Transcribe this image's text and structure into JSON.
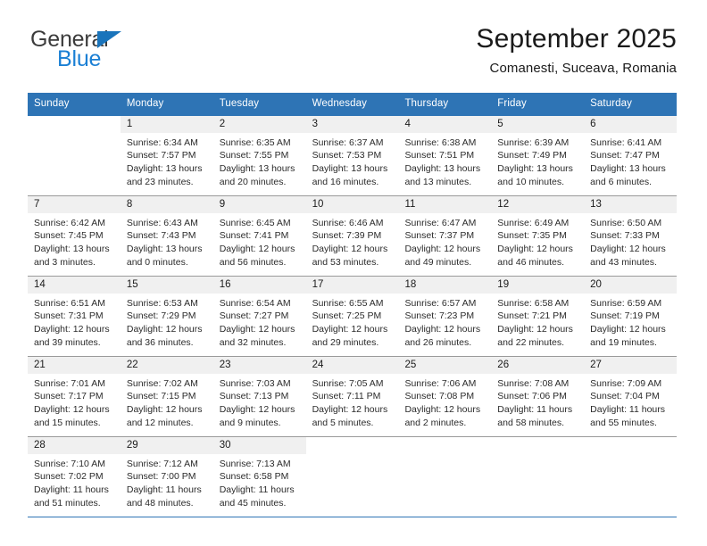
{
  "logo": {
    "word_one": "General",
    "word_two": "Blue",
    "triangle_icon": "triangle-icon",
    "brand_blue": "#1a7fd4",
    "brand_dark": "#3b3b3b"
  },
  "header": {
    "title": "September 2025",
    "subtitle": "Comanesti, Suceava, Romania"
  },
  "calendar": {
    "header_bg": "#2e74b5",
    "weekdays": [
      "Sunday",
      "Monday",
      "Tuesday",
      "Wednesday",
      "Thursday",
      "Friday",
      "Saturday"
    ],
    "weeks": [
      [
        {
          "day": "",
          "sunrise": "",
          "sunset": "",
          "daylight_line1": "",
          "daylight_line2": ""
        },
        {
          "day": "1",
          "sunrise": "Sunrise: 6:34 AM",
          "sunset": "Sunset: 7:57 PM",
          "daylight_line1": "Daylight: 13 hours",
          "daylight_line2": "and 23 minutes."
        },
        {
          "day": "2",
          "sunrise": "Sunrise: 6:35 AM",
          "sunset": "Sunset: 7:55 PM",
          "daylight_line1": "Daylight: 13 hours",
          "daylight_line2": "and 20 minutes."
        },
        {
          "day": "3",
          "sunrise": "Sunrise: 6:37 AM",
          "sunset": "Sunset: 7:53 PM",
          "daylight_line1": "Daylight: 13 hours",
          "daylight_line2": "and 16 minutes."
        },
        {
          "day": "4",
          "sunrise": "Sunrise: 6:38 AM",
          "sunset": "Sunset: 7:51 PM",
          "daylight_line1": "Daylight: 13 hours",
          "daylight_line2": "and 13 minutes."
        },
        {
          "day": "5",
          "sunrise": "Sunrise: 6:39 AM",
          "sunset": "Sunset: 7:49 PM",
          "daylight_line1": "Daylight: 13 hours",
          "daylight_line2": "and 10 minutes."
        },
        {
          "day": "6",
          "sunrise": "Sunrise: 6:41 AM",
          "sunset": "Sunset: 7:47 PM",
          "daylight_line1": "Daylight: 13 hours",
          "daylight_line2": "and 6 minutes."
        }
      ],
      [
        {
          "day": "7",
          "sunrise": "Sunrise: 6:42 AM",
          "sunset": "Sunset: 7:45 PM",
          "daylight_line1": "Daylight: 13 hours",
          "daylight_line2": "and 3 minutes."
        },
        {
          "day": "8",
          "sunrise": "Sunrise: 6:43 AM",
          "sunset": "Sunset: 7:43 PM",
          "daylight_line1": "Daylight: 13 hours",
          "daylight_line2": "and 0 minutes."
        },
        {
          "day": "9",
          "sunrise": "Sunrise: 6:45 AM",
          "sunset": "Sunset: 7:41 PM",
          "daylight_line1": "Daylight: 12 hours",
          "daylight_line2": "and 56 minutes."
        },
        {
          "day": "10",
          "sunrise": "Sunrise: 6:46 AM",
          "sunset": "Sunset: 7:39 PM",
          "daylight_line1": "Daylight: 12 hours",
          "daylight_line2": "and 53 minutes."
        },
        {
          "day": "11",
          "sunrise": "Sunrise: 6:47 AM",
          "sunset": "Sunset: 7:37 PM",
          "daylight_line1": "Daylight: 12 hours",
          "daylight_line2": "and 49 minutes."
        },
        {
          "day": "12",
          "sunrise": "Sunrise: 6:49 AM",
          "sunset": "Sunset: 7:35 PM",
          "daylight_line1": "Daylight: 12 hours",
          "daylight_line2": "and 46 minutes."
        },
        {
          "day": "13",
          "sunrise": "Sunrise: 6:50 AM",
          "sunset": "Sunset: 7:33 PM",
          "daylight_line1": "Daylight: 12 hours",
          "daylight_line2": "and 43 minutes."
        }
      ],
      [
        {
          "day": "14",
          "sunrise": "Sunrise: 6:51 AM",
          "sunset": "Sunset: 7:31 PM",
          "daylight_line1": "Daylight: 12 hours",
          "daylight_line2": "and 39 minutes."
        },
        {
          "day": "15",
          "sunrise": "Sunrise: 6:53 AM",
          "sunset": "Sunset: 7:29 PM",
          "daylight_line1": "Daylight: 12 hours",
          "daylight_line2": "and 36 minutes."
        },
        {
          "day": "16",
          "sunrise": "Sunrise: 6:54 AM",
          "sunset": "Sunset: 7:27 PM",
          "daylight_line1": "Daylight: 12 hours",
          "daylight_line2": "and 32 minutes."
        },
        {
          "day": "17",
          "sunrise": "Sunrise: 6:55 AM",
          "sunset": "Sunset: 7:25 PM",
          "daylight_line1": "Daylight: 12 hours",
          "daylight_line2": "and 29 minutes."
        },
        {
          "day": "18",
          "sunrise": "Sunrise: 6:57 AM",
          "sunset": "Sunset: 7:23 PM",
          "daylight_line1": "Daylight: 12 hours",
          "daylight_line2": "and 26 minutes."
        },
        {
          "day": "19",
          "sunrise": "Sunrise: 6:58 AM",
          "sunset": "Sunset: 7:21 PM",
          "daylight_line1": "Daylight: 12 hours",
          "daylight_line2": "and 22 minutes."
        },
        {
          "day": "20",
          "sunrise": "Sunrise: 6:59 AM",
          "sunset": "Sunset: 7:19 PM",
          "daylight_line1": "Daylight: 12 hours",
          "daylight_line2": "and 19 minutes."
        }
      ],
      [
        {
          "day": "21",
          "sunrise": "Sunrise: 7:01 AM",
          "sunset": "Sunset: 7:17 PM",
          "daylight_line1": "Daylight: 12 hours",
          "daylight_line2": "and 15 minutes."
        },
        {
          "day": "22",
          "sunrise": "Sunrise: 7:02 AM",
          "sunset": "Sunset: 7:15 PM",
          "daylight_line1": "Daylight: 12 hours",
          "daylight_line2": "and 12 minutes."
        },
        {
          "day": "23",
          "sunrise": "Sunrise: 7:03 AM",
          "sunset": "Sunset: 7:13 PM",
          "daylight_line1": "Daylight: 12 hours",
          "daylight_line2": "and 9 minutes."
        },
        {
          "day": "24",
          "sunrise": "Sunrise: 7:05 AM",
          "sunset": "Sunset: 7:11 PM",
          "daylight_line1": "Daylight: 12 hours",
          "daylight_line2": "and 5 minutes."
        },
        {
          "day": "25",
          "sunrise": "Sunrise: 7:06 AM",
          "sunset": "Sunset: 7:08 PM",
          "daylight_line1": "Daylight: 12 hours",
          "daylight_line2": "and 2 minutes."
        },
        {
          "day": "26",
          "sunrise": "Sunrise: 7:08 AM",
          "sunset": "Sunset: 7:06 PM",
          "daylight_line1": "Daylight: 11 hours",
          "daylight_line2": "and 58 minutes."
        },
        {
          "day": "27",
          "sunrise": "Sunrise: 7:09 AM",
          "sunset": "Sunset: 7:04 PM",
          "daylight_line1": "Daylight: 11 hours",
          "daylight_line2": "and 55 minutes."
        }
      ],
      [
        {
          "day": "28",
          "sunrise": "Sunrise: 7:10 AM",
          "sunset": "Sunset: 7:02 PM",
          "daylight_line1": "Daylight: 11 hours",
          "daylight_line2": "and 51 minutes."
        },
        {
          "day": "29",
          "sunrise": "Sunrise: 7:12 AM",
          "sunset": "Sunset: 7:00 PM",
          "daylight_line1": "Daylight: 11 hours",
          "daylight_line2": "and 48 minutes."
        },
        {
          "day": "30",
          "sunrise": "Sunrise: 7:13 AM",
          "sunset": "Sunset: 6:58 PM",
          "daylight_line1": "Daylight: 11 hours",
          "daylight_line2": "and 45 minutes."
        },
        {
          "day": "",
          "sunrise": "",
          "sunset": "",
          "daylight_line1": "",
          "daylight_line2": ""
        },
        {
          "day": "",
          "sunrise": "",
          "sunset": "",
          "daylight_line1": "",
          "daylight_line2": ""
        },
        {
          "day": "",
          "sunrise": "",
          "sunset": "",
          "daylight_line1": "",
          "daylight_line2": ""
        },
        {
          "day": "",
          "sunrise": "",
          "sunset": "",
          "daylight_line1": "",
          "daylight_line2": ""
        }
      ]
    ]
  }
}
